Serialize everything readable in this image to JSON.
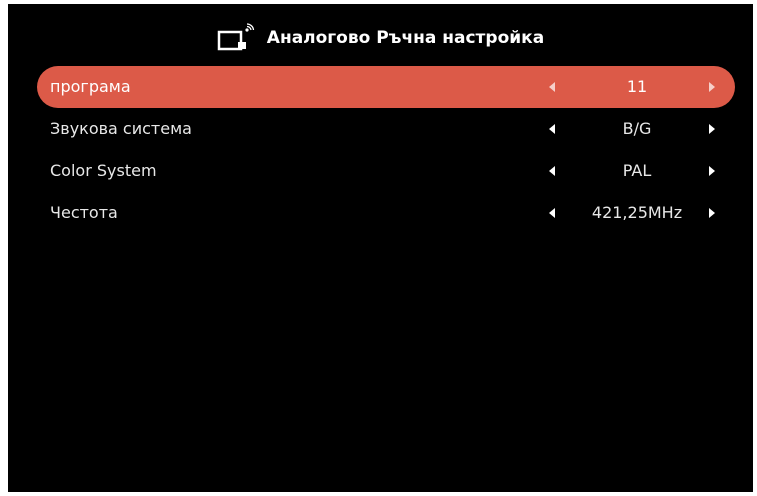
{
  "header": {
    "icon": "tv-antenna-icon",
    "title": "Аналогово Ръчна настройка"
  },
  "colors": {
    "background": "#000000",
    "highlight": "#dc5a48",
    "text": "#ffffff"
  },
  "menu": {
    "items": [
      {
        "label": "програма",
        "value": "11",
        "selected": true
      },
      {
        "label": "Звукова система",
        "value": "B/G",
        "selected": false
      },
      {
        "label": "Color System",
        "value": "PAL",
        "selected": false
      },
      {
        "label": "Честота",
        "value": "421,25MHz",
        "selected": false
      }
    ]
  }
}
